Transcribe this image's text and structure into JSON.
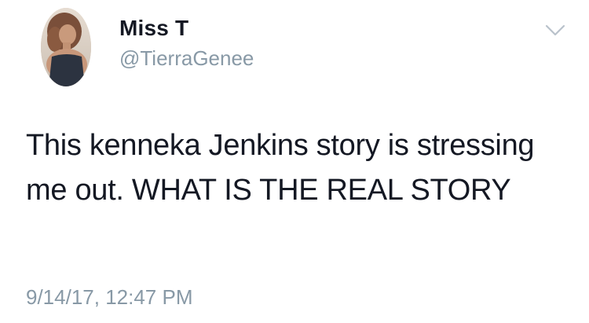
{
  "tweet": {
    "author": {
      "display_name": "Miss T",
      "handle": "@TierraGenee"
    },
    "text": "This kenneka Jenkins story is stressing me out. WHAT IS THE REAL STORY",
    "timestamp": "9/14/17, 12:47 PM"
  },
  "icons": {
    "menu": "chevron-down-icon",
    "avatar": "profile-photo"
  },
  "colors": {
    "primary_text": "#141823",
    "secondary_text": "#8899a6",
    "background": "#ffffff"
  }
}
